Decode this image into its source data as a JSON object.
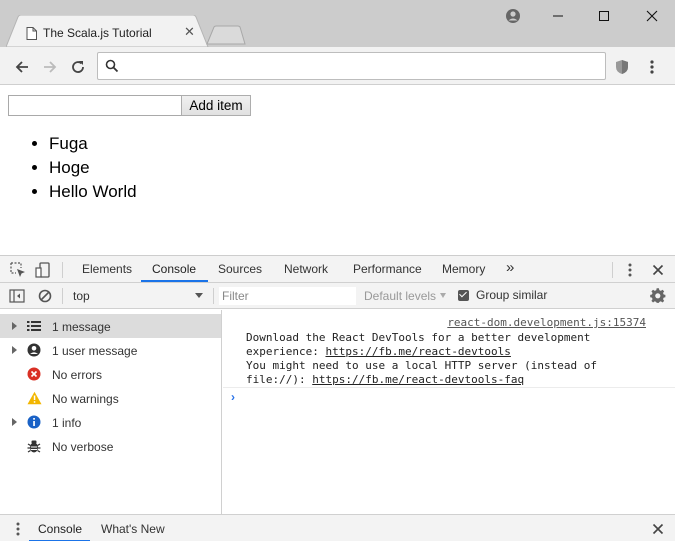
{
  "browser": {
    "tab_title": "The Scala.js Tutorial",
    "address_value": "",
    "colors": {
      "chrome": "#cccccc",
      "toolbar": "#f2f2f2"
    }
  },
  "page": {
    "input_value": "",
    "add_button_label": "Add item",
    "items": [
      "Fuga",
      "Hoge",
      "Hello World"
    ]
  },
  "devtools": {
    "tabs": [
      "Elements",
      "Console",
      "Sources",
      "Network",
      "Performance",
      "Memory"
    ],
    "active_tab": "Console",
    "more_tabs_glyph": "»",
    "context": "top",
    "filter_placeholder": "Filter",
    "levels_label": "Default levels",
    "group_similar_label": "Group similar",
    "group_similar_checked": true,
    "sidebar": [
      {
        "label": "1 message",
        "icon": "list-icon",
        "expandable": true,
        "selected": true
      },
      {
        "label": "1 user message",
        "icon": "user-icon",
        "expandable": true,
        "selected": false
      },
      {
        "label": "No errors",
        "icon": "error-icon",
        "expandable": false,
        "selected": false
      },
      {
        "label": "No warnings",
        "icon": "warning-icon",
        "expandable": false,
        "selected": false
      },
      {
        "label": "1 info",
        "icon": "info-icon",
        "expandable": true,
        "selected": false
      },
      {
        "label": "No verbose",
        "icon": "bug-icon",
        "expandable": false,
        "selected": false
      }
    ],
    "console_message": {
      "source": "react-dom.development.js:15374",
      "line1": "Download the React DevTools for a better development",
      "line2_prefix": "experience: ",
      "link1": "https://fb.me/react-devtools",
      "line3": "You might need to use a local HTTP server (instead of",
      "line4_prefix": "file://): ",
      "link2": "https://fb.me/react-devtools-faq"
    },
    "prompt_glyph": "›",
    "drawer_tabs": [
      "Console",
      "What's New"
    ],
    "accent_color": "#1a73e8"
  }
}
